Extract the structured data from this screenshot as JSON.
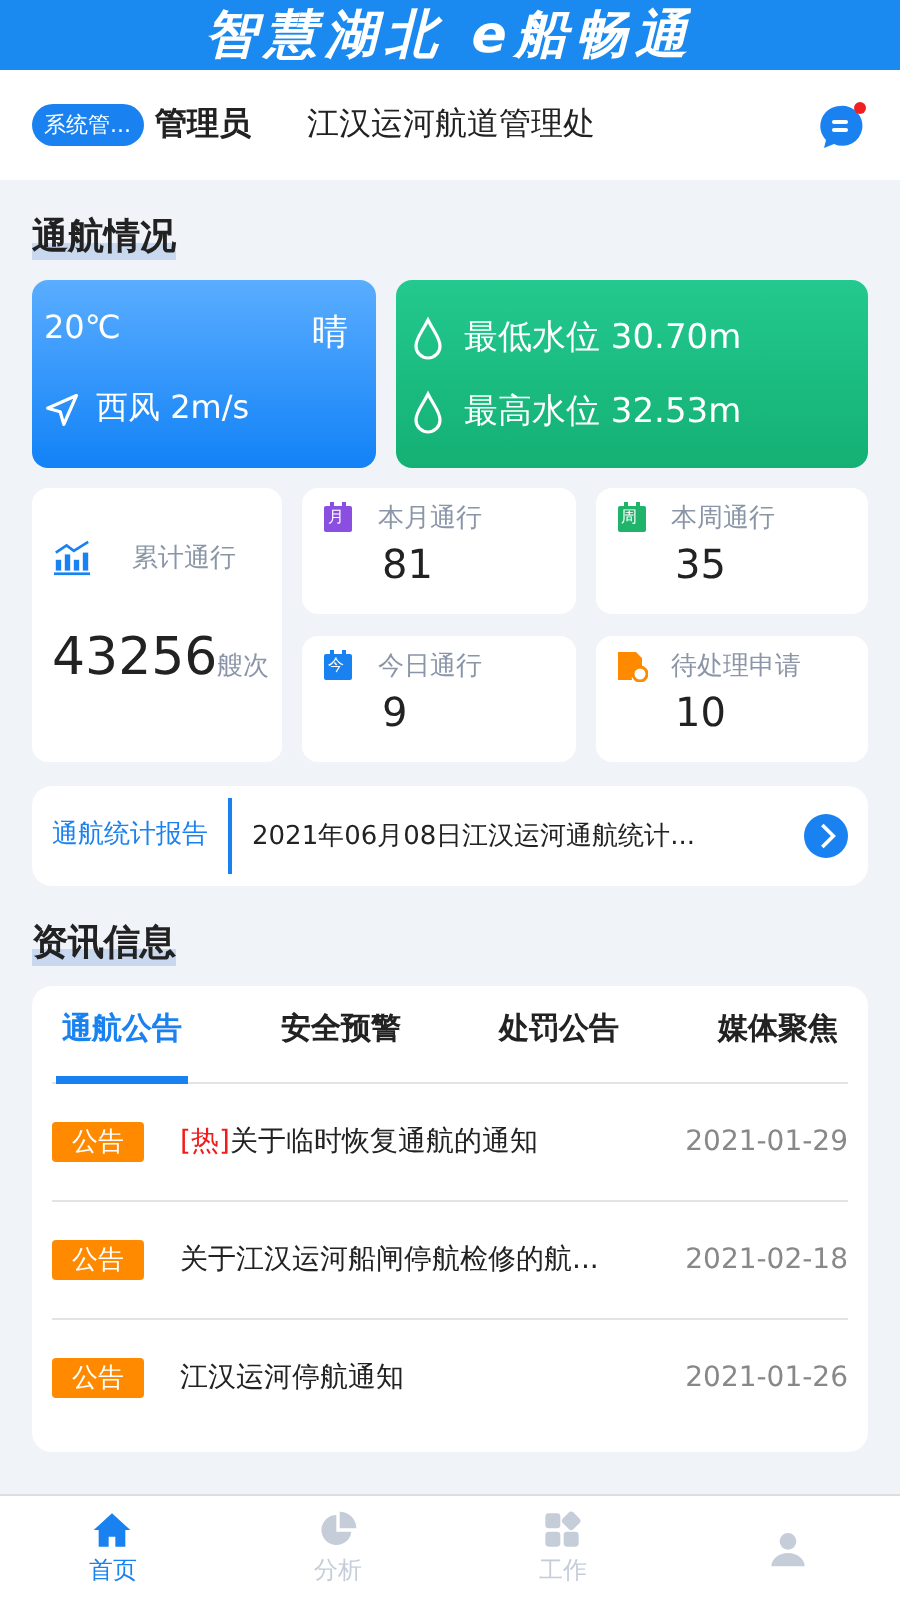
{
  "banner": {
    "title": "智慧湖北  e船畅通"
  },
  "header": {
    "role_badge": "系统管...",
    "role": "管理员",
    "org": "江汉运河航道管理处",
    "message_unread": true
  },
  "navigation_section": {
    "title": "通航情况"
  },
  "weather": {
    "temperature": "20℃",
    "condition": "晴",
    "wind": "西风 2m/s"
  },
  "water_levels": [
    {
      "label": "最低水位 30.70m"
    },
    {
      "label": "最高水位 32.53m"
    }
  ],
  "total": {
    "label": "累计通行",
    "value": "43256",
    "unit": "艘次"
  },
  "stats": [
    {
      "kind": "month",
      "badge": "月",
      "label": "本月通行",
      "value": "81",
      "color": "#8a4fe0"
    },
    {
      "kind": "week",
      "badge": "周",
      "label": "本周通行",
      "value": "35",
      "color": "#1fb36b"
    },
    {
      "kind": "today",
      "badge": "今",
      "label": "今日通行",
      "value": "9",
      "color": "#1a82f0"
    },
    {
      "kind": "pending",
      "label": "待处理申请",
      "value": "10",
      "color": "#ff8a00"
    }
  ],
  "report": {
    "label": "通航统计报告",
    "text": "2021年06月08日江汉运河通航统计..."
  },
  "news_section": {
    "title": "资讯信息"
  },
  "news_tabs": [
    {
      "label": "通航公告",
      "selected": true
    },
    {
      "label": "安全预警",
      "selected": false
    },
    {
      "label": "处罚公告",
      "selected": false
    },
    {
      "label": "媒体聚焦",
      "selected": false
    }
  ],
  "news": [
    {
      "tag": "公告",
      "hot_mark": "[热]",
      "title": "关于临时恢复通航的通知",
      "date": "2021-01-29"
    },
    {
      "tag": "公告",
      "title": "关于江汉运河船闸停航检修的航...",
      "date": "2021-02-18"
    },
    {
      "tag": "公告",
      "title": "江汉运河停航通知",
      "date": "2021-01-26"
    }
  ],
  "bottom_nav": [
    {
      "kind": "home",
      "label": "首页",
      "selected": true
    },
    {
      "kind": "chart",
      "label": "分析",
      "selected": false
    },
    {
      "kind": "apps",
      "label": "工作",
      "selected": false
    },
    {
      "kind": "profile",
      "selected": false
    }
  ]
}
